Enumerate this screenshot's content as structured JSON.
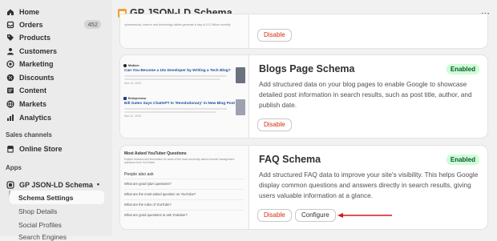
{
  "sidebar": {
    "nav": [
      {
        "label": "Home",
        "icon": "home-icon"
      },
      {
        "label": "Orders",
        "icon": "orders-icon",
        "badge": "452"
      },
      {
        "label": "Products",
        "icon": "tag-icon"
      },
      {
        "label": "Customers",
        "icon": "person-icon"
      },
      {
        "label": "Marketing",
        "icon": "target-icon"
      },
      {
        "label": "Discounts",
        "icon": "discount-icon"
      },
      {
        "label": "Content",
        "icon": "content-icon"
      },
      {
        "label": "Markets",
        "icon": "globe-icon"
      },
      {
        "label": "Analytics",
        "icon": "chart-icon"
      }
    ],
    "sales_channels_label": "Sales channels",
    "online_store": "Online Store",
    "apps_label": "Apps",
    "app_name": "GP JSON-LD Schema",
    "sub_items": [
      "Schema Settings",
      "Shop Details",
      "Social Profiles",
      "Search Engines"
    ]
  },
  "header": {
    "title": "GP JSON-LD Schema",
    "more": "⋯"
  },
  "cards": {
    "top": {
      "disable": "Disable",
      "thumb_text": "cybersecurity, science and technology dailies generate a day of 10.2 billion monthly"
    },
    "blogs": {
      "title": "Blogs Page Schema",
      "status": "Enabled",
      "description": "Add structured data on your blog pages to enable Google to showcase detailed post information in search results, such as post title, author, and publish date.",
      "disable": "Disable",
      "thumb": {
        "post1_source": "Medium",
        "post1_title": "Can You Become a 10x Developer by Writing a Tech Blog?",
        "post1_snip": "Nov 14, 2022",
        "post2_source": "Entrepreneur",
        "post2_title": "Bill Gates Says ChatGPT Is 'Revolutionary' in New Blog Post",
        "post2_snip": "Mar 22, 2023"
      }
    },
    "faq": {
      "title": "FAQ Schema",
      "status": "Enabled",
      "description": "Add structured FAQ data to improve your site's visibility. This helps Google display common questions and answers directly in search results, giving users valuable information at a glance.",
      "disable": "Disable",
      "configure": "Configure",
      "thumb": {
        "heading": "Most Asked YouTuber Questions",
        "intro": "Explore answers and information for some of the most commonly asked channel management questions from YouTubers",
        "paa": "People also ask",
        "questions": [
          "What are good Q&A questions?",
          "What are the most asked question on YouTube?",
          "What are the rules of YouTube?",
          "What are good questions to ask Youtuber?"
        ]
      }
    }
  },
  "colors": {
    "accent_red": "#d72c0d",
    "enabled_bg": "#cdfed4",
    "enabled_text": "#0c5132",
    "arrow": "#d01b1b"
  }
}
